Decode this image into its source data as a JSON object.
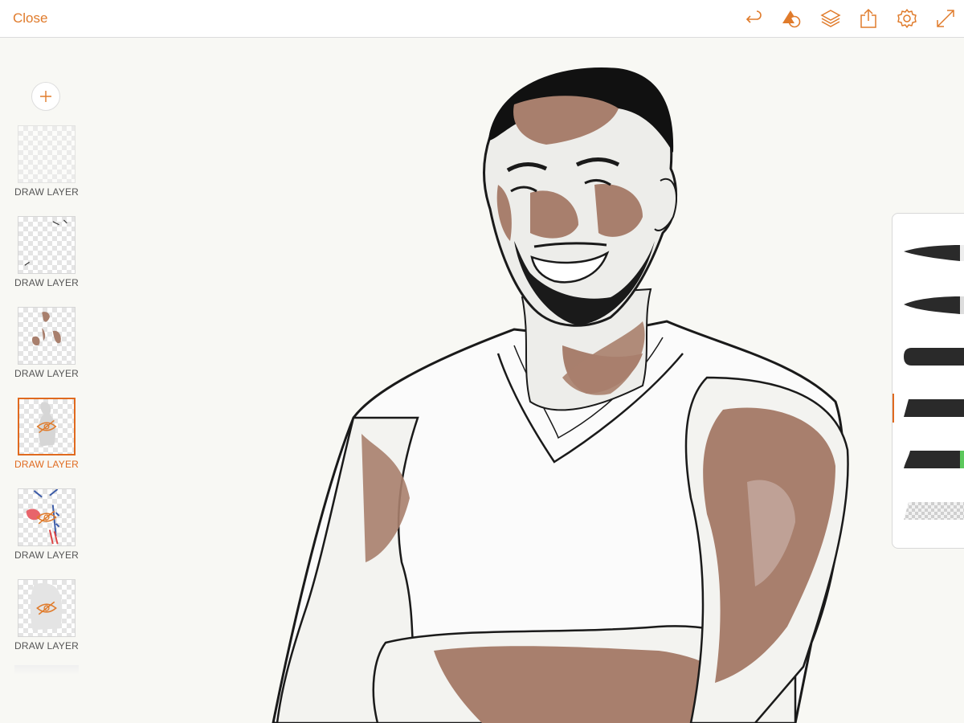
{
  "app": {
    "close_label": "Close"
  },
  "toolbar": {
    "icons": [
      "undo-icon",
      "shapes-icon",
      "layers-icon",
      "share-icon",
      "settings-icon",
      "fullscreen-icon"
    ]
  },
  "layers": [
    {
      "label": "DRAW LAYER",
      "selected": false,
      "hidden": false
    },
    {
      "label": "DRAW LAYER",
      "selected": false,
      "hidden": false
    },
    {
      "label": "DRAW LAYER",
      "selected": false,
      "hidden": false
    },
    {
      "label": "DRAW LAYER",
      "selected": true,
      "hidden": true
    },
    {
      "label": "DRAW LAYER",
      "selected": false,
      "hidden": true
    },
    {
      "label": "DRAW LAYER",
      "selected": false,
      "hidden": true
    }
  ],
  "brushes": [
    {
      "name": "pencil-brush",
      "selected": false
    },
    {
      "name": "ink-brush",
      "selected": false
    },
    {
      "name": "marker-brush",
      "selected": false
    },
    {
      "name": "flat-brush",
      "selected": true
    },
    {
      "name": "wet-brush",
      "selected": false,
      "accent": "#5cc85c"
    },
    {
      "name": "eraser-brush",
      "selected": false
    }
  ],
  "colors": {
    "accent": "#e06a1f",
    "skin": "#a87f6d",
    "ink": "#1a1a1a",
    "canvas": "#f8f8f4"
  }
}
